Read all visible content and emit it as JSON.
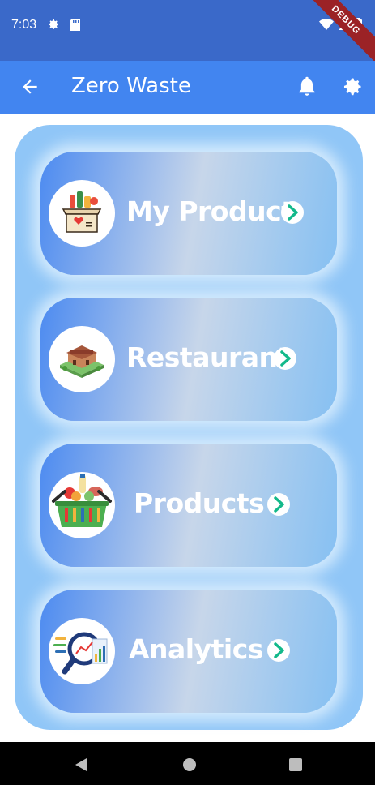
{
  "status_bar": {
    "time": "7:03",
    "debug_banner": "DEBUG"
  },
  "app_bar": {
    "title": "Zero Waste",
    "back_icon": "arrow-back-icon",
    "notification_icon": "bell-icon",
    "settings_icon": "gear-icon",
    "color": "#4285f0"
  },
  "menu": {
    "items": [
      {
        "label": "My Product",
        "icon": "gift-box-icon"
      },
      {
        "label": "Restaurant",
        "icon": "restaurant-icon"
      },
      {
        "label": "Products",
        "icon": "grocery-basket-icon"
      },
      {
        "label": "Analytics",
        "icon": "analytics-icon"
      }
    ],
    "arrow_icon": "chevron-right-circle-icon",
    "arrow_color": "#13b98a"
  },
  "colors": {
    "status_bar": "#3a69c9",
    "panel": "#90c6f7"
  }
}
